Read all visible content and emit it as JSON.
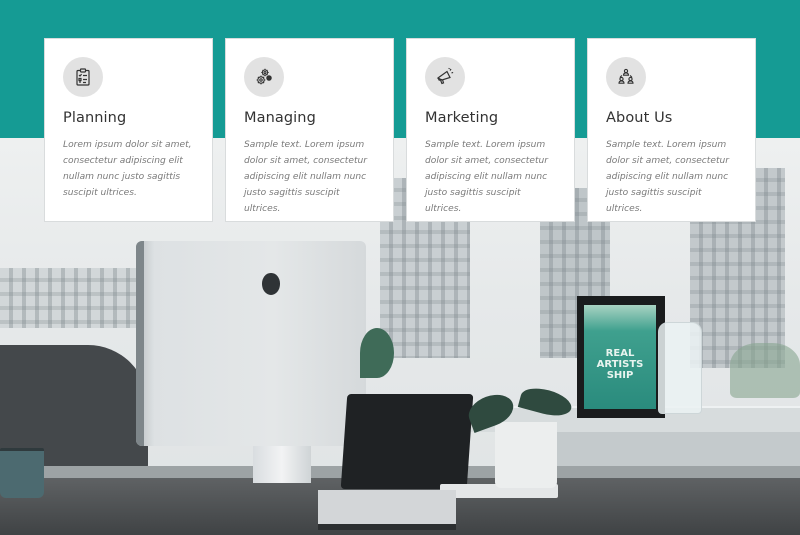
{
  "theme": {
    "accent": "#159b94",
    "card_background": "#ffffff",
    "icon_circle": "#e2e2e2",
    "heading_color": "#333333",
    "body_color": "#7a7a7a"
  },
  "cards": [
    {
      "icon": "clipboard-checklist-icon",
      "title": "Planning",
      "text": "Lorem ipsum dolor sit amet, consectetur adipiscing elit nullam nunc justo sagittis suscipit ultrices."
    },
    {
      "icon": "gears-icon",
      "title": "Managing",
      "text": "Sample text. Lorem ipsum dolor sit amet, consectetur adipiscing elit nullam nunc justo sagittis suscipit ultrices."
    },
    {
      "icon": "megaphone-icon",
      "title": "Marketing",
      "text": "Sample text. Lorem ipsum dolor sit amet, consectetur adipiscing elit nullam nunc justo sagittis suscipit ultrices."
    },
    {
      "icon": "team-network-icon",
      "title": "About Us",
      "text": "Sample text. Lorem ipsum dolor sit amet, consectetur adipiscing elit nullam nunc justo sagittis suscipit ultrices."
    }
  ],
  "background_photo": {
    "subject": "office desk with iMac, laptop, orchid and framed poster by a window",
    "poster_text": [
      "REAL",
      "ARTISTS",
      "SHIP"
    ]
  }
}
